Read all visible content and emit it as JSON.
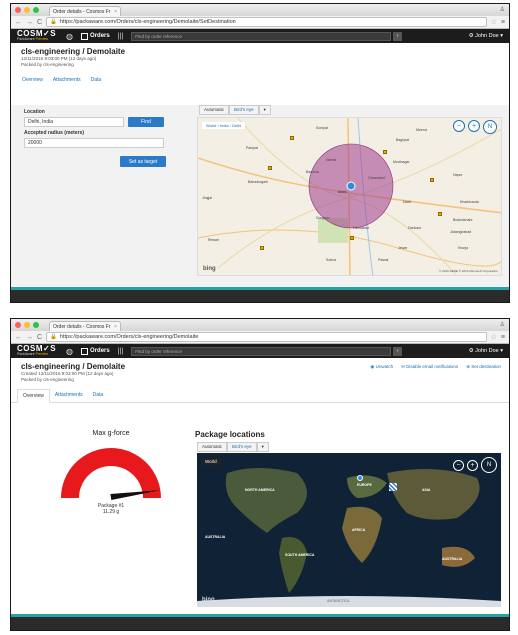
{
  "screen1": {
    "tab_title": "Order details - Cosmos Fr",
    "url": "https://packaware.com/Orders/cls-engineering/Demolaite/SetDestination",
    "logo": "COSM✓S",
    "logo_sub": "PackAware",
    "logo_badge": "Preview",
    "orders_label": "Orders",
    "search_placeholder": "Find by order reference",
    "user": "John Doe",
    "title": "cls-engineering / Demolaite",
    "created": "12/11/2016 8:03:00 PM (12 days ago)",
    "packed_by": "Packed by cls-engineering",
    "tabs": [
      "Overview",
      "Attachments",
      "Data"
    ],
    "location_label": "Location",
    "location_value": "Delhi, India",
    "find_label": "Find",
    "radius_label": "Accepted radius (meters)",
    "radius_value": "20000",
    "set_target_label": "Set as target",
    "map_mode": "Automatic",
    "map_view": "Bird's eye",
    "breadcrumb": "World › India › Delhi",
    "map_places": [
      "Sonipat",
      "Baghpat",
      "Meerut",
      "Modinagar",
      "Panipat",
      "Narela",
      "Bawana",
      "Ghaziabad",
      "Dadri",
      "Delhi",
      "Gurgaon",
      "Faridabad",
      "Bahadurgarh",
      "Jhajjar",
      "Rewari",
      "Hapur",
      "Bulandshahr",
      "Jewar",
      "Kharkhauda",
      "Palwal",
      "Sohna",
      "Khurja",
      "Dankaur",
      "Jahangirabad"
    ],
    "bing": "bing",
    "copyright": "© 2016 HERE © 2016 Microsoft Corporation"
  },
  "screen2": {
    "tab_title": "Order details - Cosmos Fr",
    "url": "https://packaware.com/Orders/cls-engineering/Demolaite",
    "logo": "COSM✓S",
    "logo_sub": "PackAware",
    "logo_badge": "Preview",
    "orders_label": "Orders",
    "search_placeholder": "Find by order reference",
    "user": "John Doe",
    "title": "cls-engineering / Demolaite",
    "created": "Created 12/11/2016 8:03:00 PM (12 days ago)",
    "packed_by": "Packed by cls-engineering",
    "actions": [
      "Unwatch",
      "Disable email notifications",
      "Set destination"
    ],
    "tabs": [
      "Overview",
      "Attachments",
      "Data"
    ],
    "gforce_title": "Max g-force",
    "package_label": "Package #1",
    "package_value": "11.29 g",
    "gforce_level": 0.95,
    "locations_title": "Package locations",
    "map_mode": "Automatic",
    "map_view": "Bird's eye",
    "world_label": "World",
    "continents": [
      "NORTH AMERICA",
      "EUROPE",
      "ASIA",
      "AFRICA",
      "SOUTH AMERICA",
      "AUSTRALIA",
      "ANTARCTICA"
    ],
    "bing": "bing"
  },
  "colors": {
    "accent": "#2a7ac8",
    "gauge": "#e8191c",
    "teal": "#27a3a8",
    "circle": "#a03d8d"
  }
}
